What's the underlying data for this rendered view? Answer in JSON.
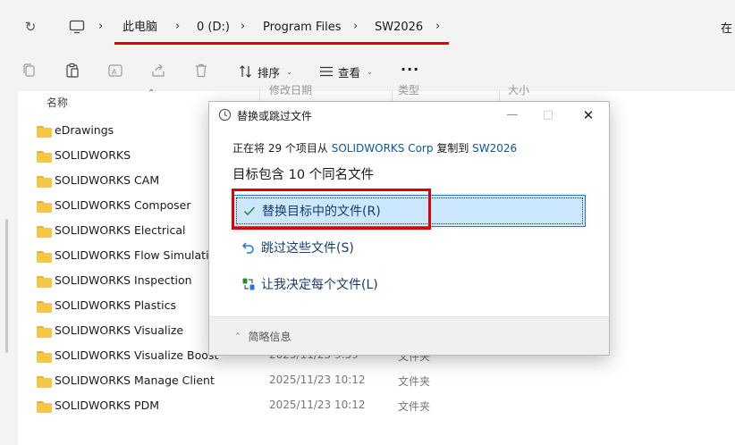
{
  "address": {
    "crumbs": [
      "此电脑",
      "0 (D:)",
      "Program Files",
      "SW2026"
    ],
    "edge_text": "在"
  },
  "toolbar": {
    "sort_label": "排序",
    "view_label": "查看",
    "more_label": "···"
  },
  "columns": {
    "name": "名称",
    "date": "修改日期",
    "type": "类型",
    "size": "大小"
  },
  "files": [
    {
      "name": "eDrawings",
      "date": "",
      "type": ""
    },
    {
      "name": "SOLIDWORKS",
      "date": "",
      "type": ""
    },
    {
      "name": "SOLIDWORKS CAM",
      "date": "",
      "type": ""
    },
    {
      "name": "SOLIDWORKS Composer",
      "date": "",
      "type": ""
    },
    {
      "name": "SOLIDWORKS Electrical",
      "date": "",
      "type": ""
    },
    {
      "name": "SOLIDWORKS Flow Simulation",
      "date": "",
      "type": ""
    },
    {
      "name": "SOLIDWORKS Inspection",
      "date": "",
      "type": ""
    },
    {
      "name": "SOLIDWORKS Plastics",
      "date": "",
      "type": ""
    },
    {
      "name": "SOLIDWORKS Visualize",
      "date": "",
      "type": ""
    },
    {
      "name": "SOLIDWORKS Visualize Boost",
      "date": "2025/11/23 9:59",
      "type": "文件夹"
    },
    {
      "name": "SOLIDWORKS Manage Client",
      "date": "2025/11/23 10:12",
      "type": "文件夹"
    },
    {
      "name": "SOLIDWORKS PDM",
      "date": "2025/11/23 10:12",
      "type": "文件夹"
    }
  ],
  "dialog": {
    "title": "替换或跳过文件",
    "copying_prefix": "正在将 29 个项目从",
    "source": "SOLIDWORKS Corp",
    "copying_mid": "复制到",
    "destination": "SW2026",
    "heading": "目标包含 10 个同名文件",
    "options": {
      "replace": "替换目标中的文件(R)",
      "skip": "跳过这些文件(S)",
      "decide": "让我决定每个文件(L)"
    },
    "details": "简略信息"
  },
  "colors": {
    "accent": "#0a56a8",
    "selection": "#cce8ff",
    "annotation_red": "#e00000",
    "folder": "#f6c646"
  }
}
